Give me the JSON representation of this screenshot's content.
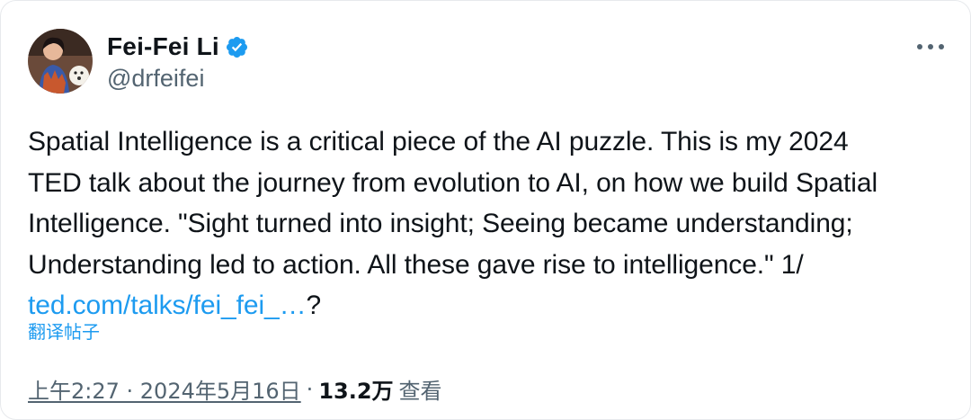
{
  "author": {
    "display_name": "Fei-Fei Li",
    "handle": "@drfeifei",
    "verified_icon": "verified-badge-icon",
    "avatar_icon": "avatar"
  },
  "actions": {
    "more_icon": "more-horizontal-icon"
  },
  "tweet": {
    "lines": [
      "Spatial Intelligence is a critical piece of the AI puzzle. This is my 2024",
      "TED talk about the journey from evolution to AI, on how we build Spatial",
      "Intelligence. \"Sight turned into insight; Seeing became understanding;",
      "Understanding led to action. All these gave rise to intelligence.\" 1/"
    ],
    "link_text": "ted.com/talks/fei_fei_…",
    "link_suffix": "?",
    "translate_label": "翻译帖子"
  },
  "meta": {
    "time": "上午2:27 · 2024年5月16日",
    "separator": "·",
    "views_count": "13.2万",
    "views_label": "查看"
  },
  "colors": {
    "accent": "#1d9bf0",
    "text": "#0f1419",
    "secondary": "#536471"
  }
}
